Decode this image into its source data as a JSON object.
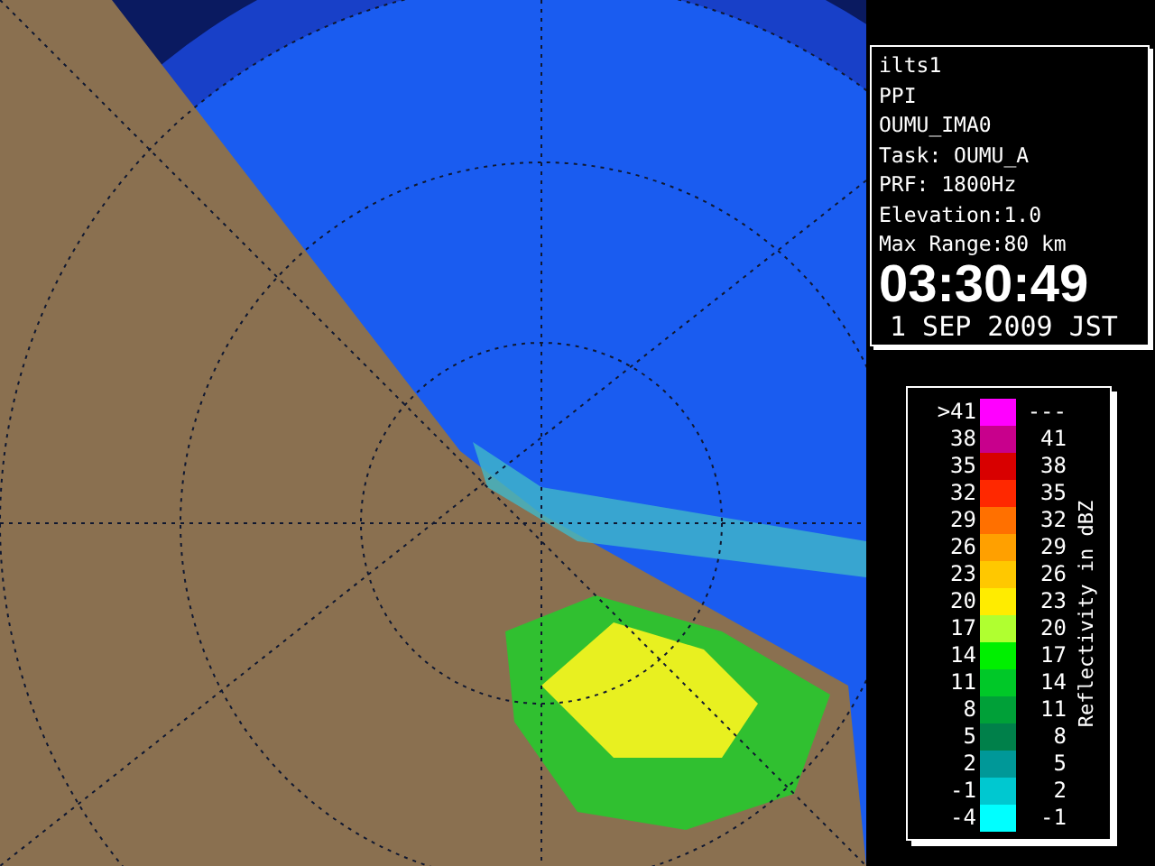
{
  "info_panel": {
    "lines": [
      "ilts1",
      "PPI",
      "OUMU_IMA0",
      "Task: OUMU_A",
      "PRF: 1800Hz",
      "Elevation:1.0",
      "Max Range:80 km"
    ],
    "time": "03:30:49",
    "date": "1 SEP 2009 JST"
  },
  "legend": {
    "title": "Reflectivity in dBZ",
    "rows": [
      {
        "low": ">41",
        "high": "---",
        "color": "#ff00ff"
      },
      {
        "low": "38",
        "high": "41",
        "color": "#c8008c"
      },
      {
        "low": "35",
        "high": "38",
        "color": "#d80000"
      },
      {
        "low": "32",
        "high": "35",
        "color": "#ff2800"
      },
      {
        "low": "29",
        "high": "32",
        "color": "#ff7000"
      },
      {
        "low": "26",
        "high": "29",
        "color": "#ffa000"
      },
      {
        "low": "23",
        "high": "26",
        "color": "#ffc800"
      },
      {
        "low": "20",
        "high": "23",
        "color": "#ffec00"
      },
      {
        "low": "17",
        "high": "20",
        "color": "#b0ff30"
      },
      {
        "low": "14",
        "high": "17",
        "color": "#00f000"
      },
      {
        "low": "11",
        "high": "14",
        "color": "#00c828"
      },
      {
        "low": "8",
        "high": "11",
        "color": "#00a038"
      },
      {
        "low": "5",
        "high": "8",
        "color": "#00804a"
      },
      {
        "low": "2",
        "high": "5",
        "color": "#009898"
      },
      {
        "low": "-1",
        "high": "2",
        "color": "#00c8d0"
      },
      {
        "low": "-4",
        "high": "-1",
        "color": "#00ffff"
      }
    ]
  }
}
